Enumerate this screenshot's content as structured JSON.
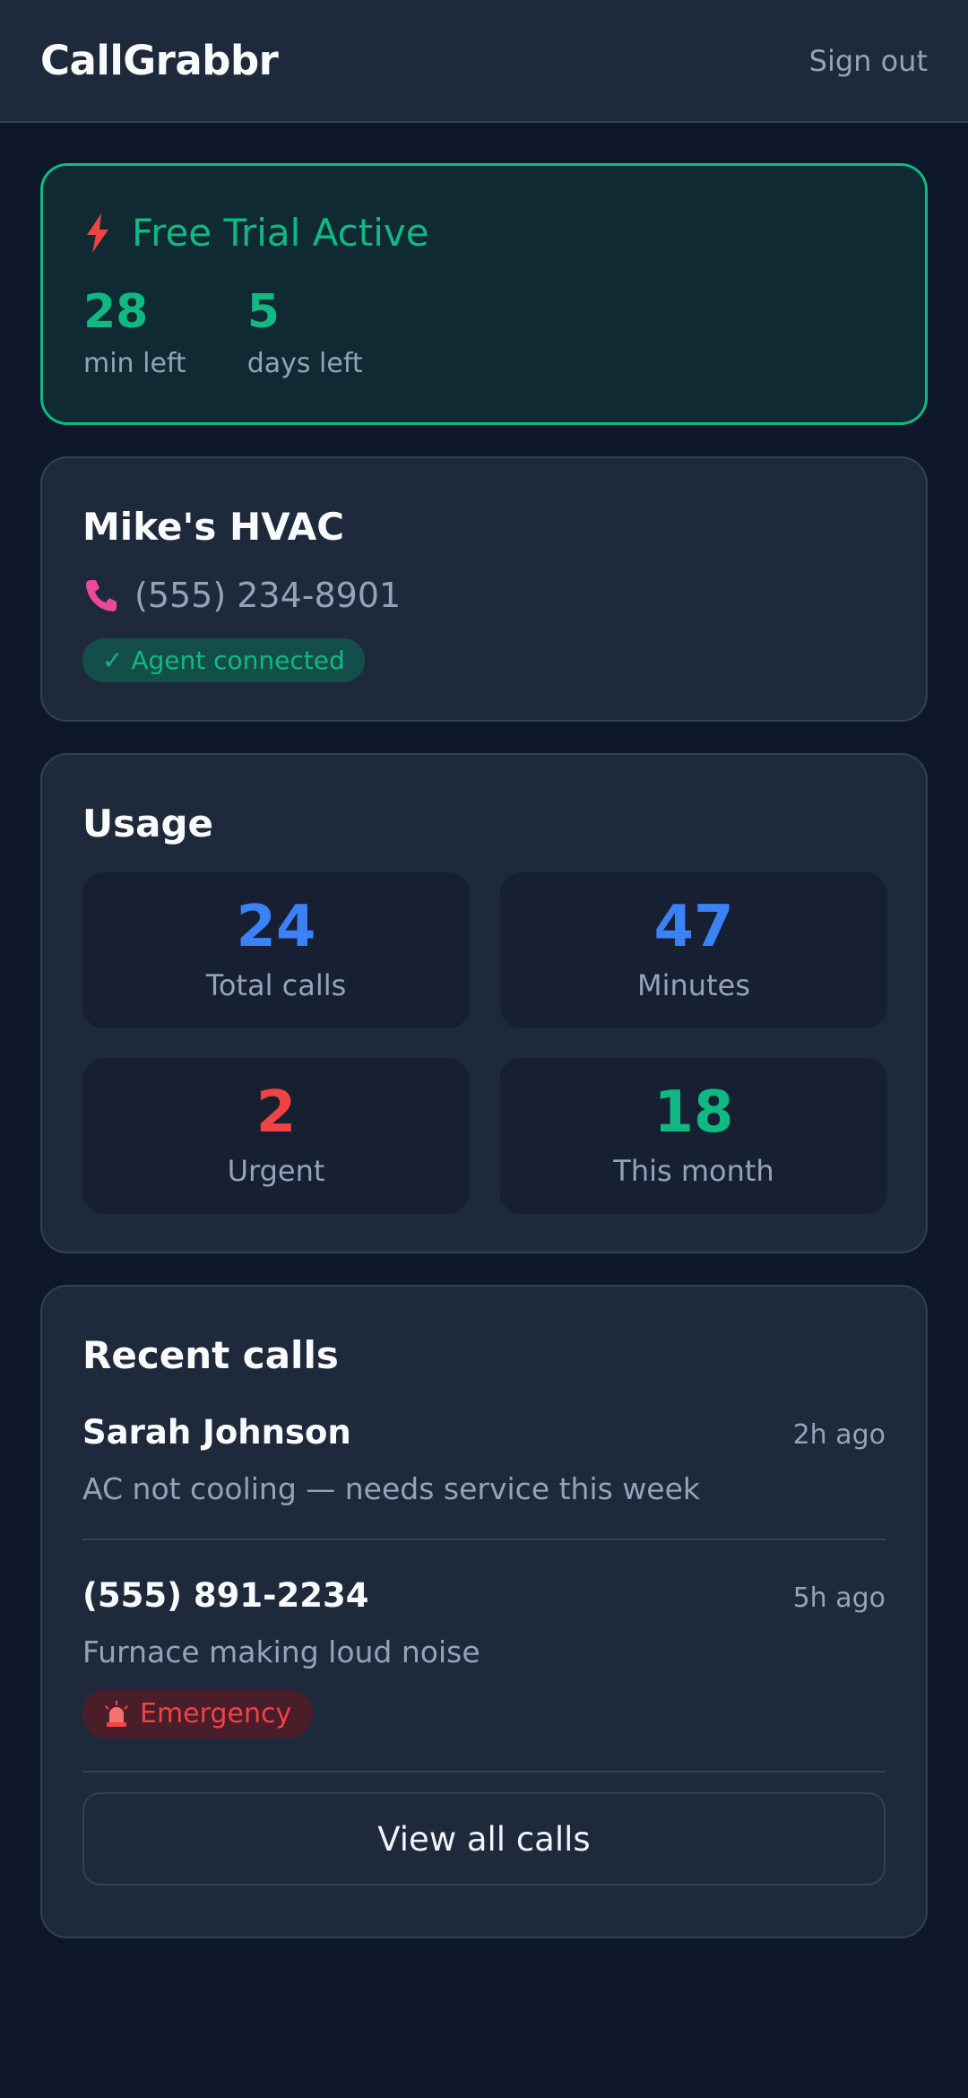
{
  "header": {
    "brand": "CallGrabbr",
    "signout": "Sign out"
  },
  "trial": {
    "title": "Free Trial Active",
    "minutes_left": "28",
    "minutes_label": "min left",
    "days_left": "5",
    "days_label": "days left"
  },
  "business": {
    "name": "Mike's HVAC",
    "phone": "(555) 234-8901",
    "status": "✓ Agent connected"
  },
  "usage": {
    "title": "Usage",
    "tiles": [
      {
        "value": "24",
        "label": "Total calls",
        "color": "#3b82f6"
      },
      {
        "value": "47",
        "label": "Minutes",
        "color": "#3b82f6"
      },
      {
        "value": "2",
        "label": "Urgent",
        "color": "#ef4444"
      },
      {
        "value": "18",
        "label": "This month",
        "color": "#10b981"
      }
    ]
  },
  "recent": {
    "title": "Recent calls",
    "calls": [
      {
        "name": "Sarah Johnson",
        "time": "2h ago",
        "desc": "AC not cooling — needs service this week"
      },
      {
        "name": "(555) 891-2234",
        "time": "5h ago",
        "desc": "Furnace making loud noise",
        "badge": "Emergency"
      }
    ],
    "view_all": "View all calls"
  },
  "colors": {
    "accent_green": "#10b981",
    "accent_blue": "#3b82f6",
    "accent_red": "#ef4444",
    "background": "#0f172a",
    "card": "#1e293b"
  }
}
